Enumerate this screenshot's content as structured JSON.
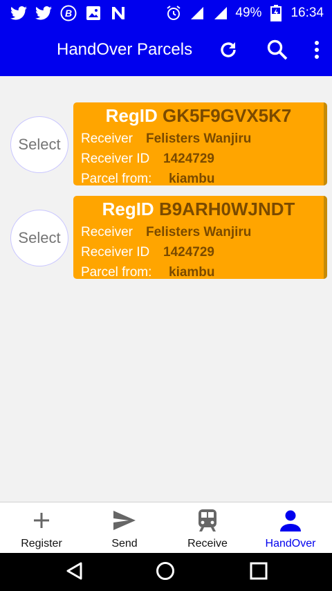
{
  "statusbar": {
    "battery": "49%",
    "time": "16:34",
    "left_icons": [
      "twitter-icon",
      "twitter-icon",
      "bitcoin-icon",
      "image-icon",
      "n-icon"
    ],
    "right_icons": [
      "alarm-icon",
      "signal-icon",
      "signal-icon",
      "battery-icon"
    ]
  },
  "appbar": {
    "title": "HandOver Parcels",
    "icons": [
      "refresh-icon",
      "search-icon",
      "more-vert-icon"
    ]
  },
  "parcels": [
    {
      "select_label": "Select",
      "regid_label": "RegID",
      "regid": "GK5F9GVX5K7",
      "receiver_label": "Receiver",
      "receiver": "Felisters Wanjiru",
      "receiver_id_label": "Receiver ID",
      "receiver_id": "1424729",
      "parcel_from_label": "Parcel from:",
      "parcel_from": "kiambu"
    },
    {
      "select_label": "Select",
      "regid_label": "RegID",
      "regid": "B9ARH0WJNDT",
      "receiver_label": "Receiver",
      "receiver": "Felisters Wanjiru",
      "receiver_id_label": "Receiver ID",
      "receiver_id": "1424729",
      "parcel_from_label": "Parcel from:",
      "parcel_from": "kiambu"
    }
  ],
  "bottom_nav": [
    {
      "label": "Register",
      "icon": "plus-icon",
      "active": false
    },
    {
      "label": "Send",
      "icon": "send-icon",
      "active": false
    },
    {
      "label": "Receive",
      "icon": "train-icon",
      "active": false
    },
    {
      "label": "HandOver",
      "icon": "person-icon",
      "active": true
    }
  ],
  "colors": {
    "primary": "#0000ee",
    "card": "#ffa500",
    "card_value": "#7a4a00",
    "background": "#f2f2f2"
  }
}
